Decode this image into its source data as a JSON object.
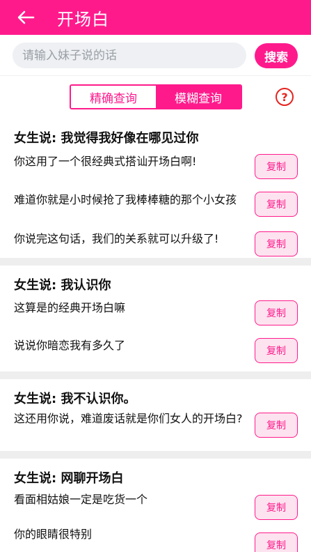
{
  "appbar": {
    "title": "开场白",
    "back_icon": "arrow-left-icon"
  },
  "search": {
    "placeholder": "请输入妹子说的话",
    "button_label": "搜索"
  },
  "mode": {
    "tabs": [
      {
        "label": "精确查询",
        "active": false
      },
      {
        "label": "模糊查询",
        "active": true
      }
    ],
    "help_icon": "?"
  },
  "colors": {
    "accent": "#ff1a8c",
    "copy_bg": "#fde3ef",
    "help": "#e5241f"
  },
  "sections": [
    {
      "title": "女生说: 我觉得我好像在哪见过你",
      "items": [
        {
          "text": "你这用了一个很经典式搭讪开场白啊!",
          "copy": "复制"
        },
        {
          "text": "难道你就是小时候抢了我棒棒糖的那个小女孩",
          "copy": "复制"
        },
        {
          "text": "你说完这句话，我们的关系就可以升级了!",
          "copy": "复制"
        }
      ]
    },
    {
      "title": "女生说: 我认识你",
      "items": [
        {
          "text": "这算是的经典开场白嘛",
          "copy": "复制"
        },
        {
          "text": "说说你暗恋我有多久了",
          "copy": "复制"
        }
      ]
    },
    {
      "title": "女生说: 我不认识你。",
      "items": [
        {
          "text": "这还用你说，难道废话就是你们女人的开场白?",
          "copy": "复制"
        }
      ]
    },
    {
      "title": "女生说: 网聊开场白",
      "items": [
        {
          "text": "看面相姑娘一定是吃货一个",
          "copy": "复制"
        },
        {
          "text": "你的眼睛很特别",
          "copy": "复制"
        }
      ]
    }
  ]
}
